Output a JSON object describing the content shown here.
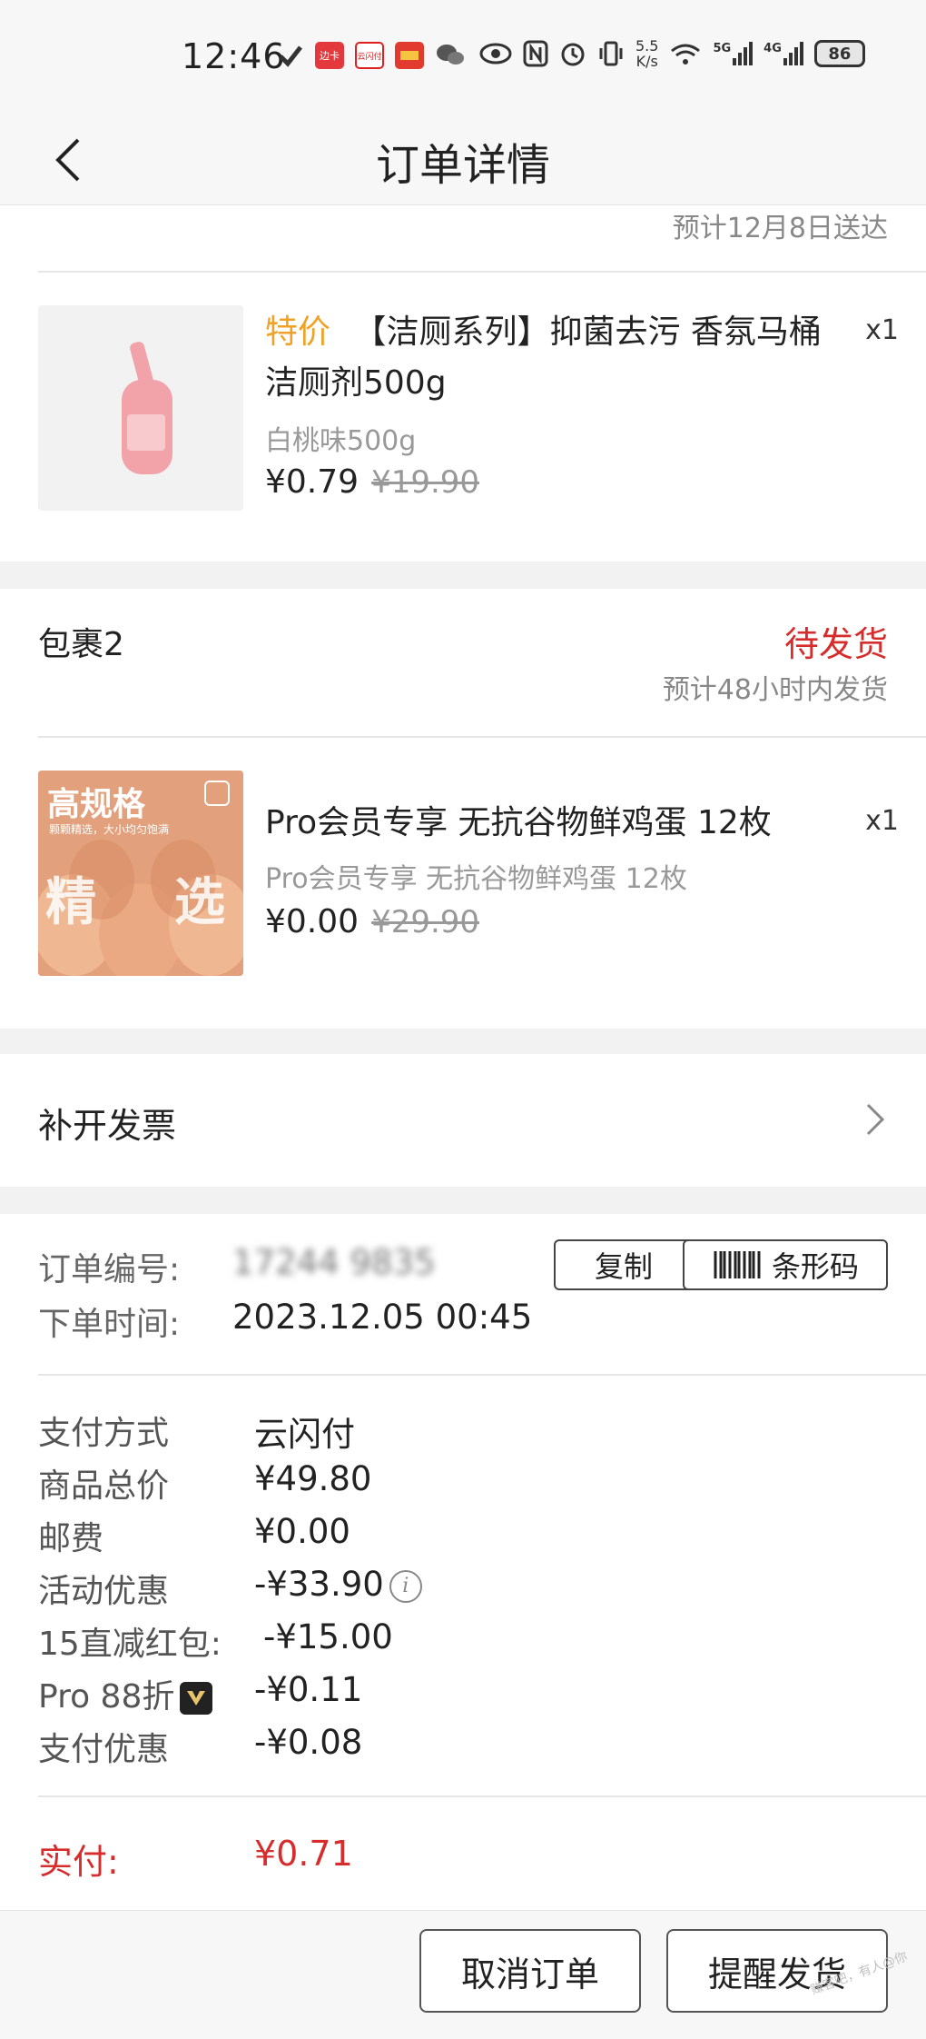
{
  "status_bar": {
    "time": "12:46",
    "apps": [
      {
        "icon": "jingdong-app-icon",
        "color": "#e4393c",
        "label": "边卡"
      },
      {
        "icon": "unionpay-app-icon",
        "color": "#e02020",
        "label": "云闪付"
      },
      {
        "icon": "notes-app-icon",
        "color": "#f2a33a",
        "label": ""
      },
      {
        "icon": "wechat-icon",
        "color": "#555555",
        "label": ""
      }
    ],
    "net_speed_value": "5.5",
    "net_speed_unit": "K/s",
    "network_labels": [
      "5G",
      "4G"
    ],
    "battery": "86"
  },
  "nav": {
    "title": "订单详情",
    "back_icon": "chevron-left-icon"
  },
  "package1": {
    "eta": "预计12月8日送达",
    "product": {
      "tag": "特价",
      "title": "【洁厕系列】抑菌去污 香氛马桶洁厕剂500g",
      "qty": "x1",
      "spec": "白桃味500g",
      "price": "¥0.79",
      "original_price": "¥19.90",
      "thumb_color": "#f1a3a9"
    }
  },
  "package2": {
    "label": "包裹2",
    "status": "待发货",
    "eta": "预计48小时内发货",
    "product": {
      "title": "Pro会员专享 无抗谷物鲜鸡蛋 12枚",
      "qty": "x1",
      "spec": "Pro会员专享 无抗谷物鲜鸡蛋 12枚",
      "price": "¥0.00",
      "original_price": "¥29.90",
      "thumb_heading": "高规格",
      "thumb_sub": "颗颗精选，大小均匀饱满",
      "thumb_big_left": "精",
      "thumb_big_right": "选",
      "thumb_color": "#e8a27a"
    }
  },
  "invoice": {
    "label": "补开发票",
    "chevron_icon": "chevron-right-icon"
  },
  "order_info": {
    "order_no_label": "订单编号:",
    "order_no_value": "17244 9835",
    "copy_label": "复制",
    "barcode_label": "条形码",
    "barcode_icon": "barcode-icon",
    "time_label": "下单时间:",
    "time_value": "2023.12.05 00:45"
  },
  "payment": {
    "rows": [
      {
        "label": "支付方式",
        "value": "云闪付"
      },
      {
        "label": "商品总价",
        "value": "¥49.80"
      },
      {
        "label": "邮费",
        "value": "¥0.00"
      },
      {
        "label": "活动优惠",
        "value": "-¥33.90"
      },
      {
        "label": "15直减红包:",
        "value": "-¥15.00"
      },
      {
        "label": "Pro 88折",
        "value": "-¥0.11"
      },
      {
        "label": "支付优惠",
        "value": "-¥0.08"
      }
    ],
    "info_icon": "info-icon",
    "pro_badge_icon": "pro-badge-icon",
    "actual_label": "实付:",
    "actual_value": "¥0.71"
  },
  "footer": {
    "cancel_label": "取消订单",
    "remind_label": "提醒发货",
    "watermark": "赚客吧，有人@你"
  },
  "colors": {
    "accent_red": "#d62c2c",
    "sale_orange": "#f0a227",
    "muted_gray": "#999999"
  }
}
